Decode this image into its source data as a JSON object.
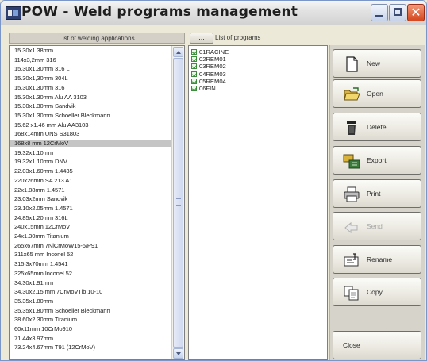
{
  "window": {
    "title": "POW - Weld programs management"
  },
  "headers": {
    "applications": "List of welding applications",
    "programs_button": "...",
    "programs": "List of programs"
  },
  "applications": [
    "15.30x1.38mm",
    "114x3,2mm 316",
    "15.30x1,30mm 316 L",
    "15.30x1,30mm 304L",
    "15.30x1,30mm 316",
    "15.30x1.30mm Alu AA 3103",
    "15.30x1.30mm Sandvik",
    "15.30x1.30mm Schoeller Bleckmann",
    "15.62 x1.46 mm Alu AA3103",
    "168x14mm UNS S31803",
    "168x8 mm 12CrMoV",
    "19.32x1.10mm",
    "19.32x1.10mm DNV",
    "22.03x1.60mm 1.4435",
    "220x26mm SA 213 A1",
    "22x1.88mm 1.4571",
    "23.03x2mm Sandvik",
    "23.10x2.05mm 1.4571",
    "24.85x1.20mm 316L",
    "240x15mm 12CrMoV",
    "24x1.30mm Titanium",
    "265x67mm 7NiCrMoW15-6/P91",
    "311x65 mm Inconel 52",
    "315.3x70mm 1.4541",
    "325x65mm Inconel 52",
    "34.30x1.91mm",
    "34.30x2.15 mm 7CrMoVTib 10-10",
    "35.35x1.80mm",
    "35.35x1.80mm Schoeller Bleckmann",
    "38.60x2.30mm Titanium",
    "60x11mm 10CrMo910",
    "71.44x3.97mm",
    "73.24x4.67mm T91 (12CrMoV)"
  ],
  "selected_application": "168x8 mm 12CrMoV",
  "programs": [
    "01RACINE",
    "02REM01",
    "03REM02",
    "04REM03",
    "05REM04",
    "06FIN"
  ],
  "buttons": {
    "new": "New",
    "open": "Open",
    "delete": "Delete",
    "export": "Export",
    "print": "Print",
    "send": "Send",
    "rename": "Rename",
    "copy": "Copy",
    "close": "Close"
  }
}
